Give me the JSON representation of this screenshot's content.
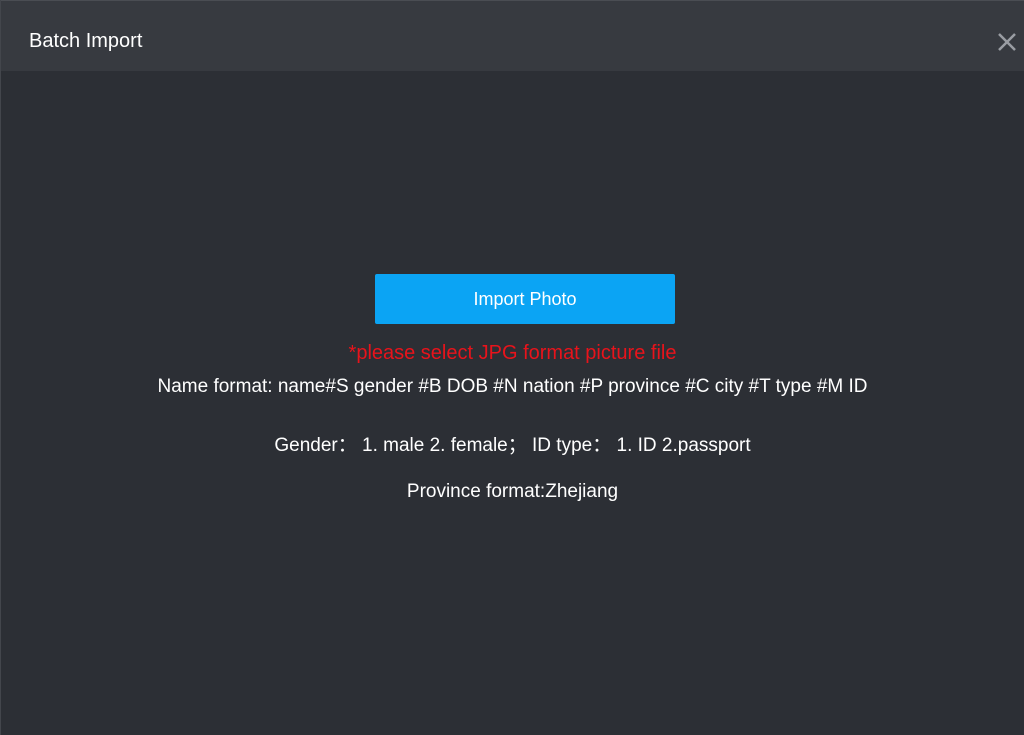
{
  "dialog": {
    "title": "Batch Import",
    "close_icon": "close-icon"
  },
  "main": {
    "import_button_label": "Import Photo",
    "warning_text": "*please select JPG format picture file",
    "name_format_text": "Name format: name#S gender #B DOB #N nation #P province #C city #T type #M ID",
    "gender_text": "Gender： 1. male  2. female； ID type： 1. ID 2.passport",
    "province_text": "Province format:Zhejiang"
  },
  "colors": {
    "background": "#2c2f35",
    "titlebar": "#373a40",
    "accent": "#0ba4f4",
    "warning": "#e8131b",
    "text": "#ffffff"
  }
}
